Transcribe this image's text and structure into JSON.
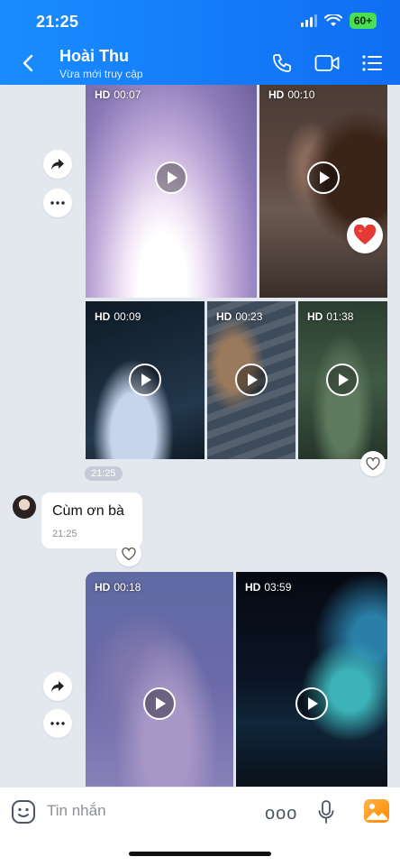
{
  "status": {
    "time": "21:25",
    "battery": "60+"
  },
  "header": {
    "name": "Hoài Thu",
    "status": "Vừa mới truy cập"
  },
  "videos": {
    "v1": {
      "quality": "HD",
      "duration": "00:07"
    },
    "v2": {
      "quality": "HD",
      "duration": "00:10"
    },
    "v3": {
      "quality": "HD",
      "duration": "00:09"
    },
    "v4": {
      "quality": "HD",
      "duration": "00:23"
    },
    "v5": {
      "quality": "HD",
      "duration": "01:38"
    },
    "v6": {
      "quality": "HD",
      "duration": "00:18"
    },
    "v7": {
      "quality": "HD",
      "duration": "03:59"
    }
  },
  "group1_time": "21:25",
  "message": {
    "text": "Cùm ơn bà",
    "time": "21:25"
  },
  "input": {
    "placeholder": "Tin nhắn",
    "more": "ooo"
  },
  "colors": {
    "header": "#1a8cff",
    "chat_bg": "#e3e8ef",
    "reaction": "#e53935"
  },
  "icons": [
    "back-icon",
    "phone-icon",
    "video-call-icon",
    "menu-icon",
    "share-icon",
    "more-icon",
    "heart-icon",
    "emoji-icon",
    "mic-icon",
    "gallery-icon"
  ]
}
